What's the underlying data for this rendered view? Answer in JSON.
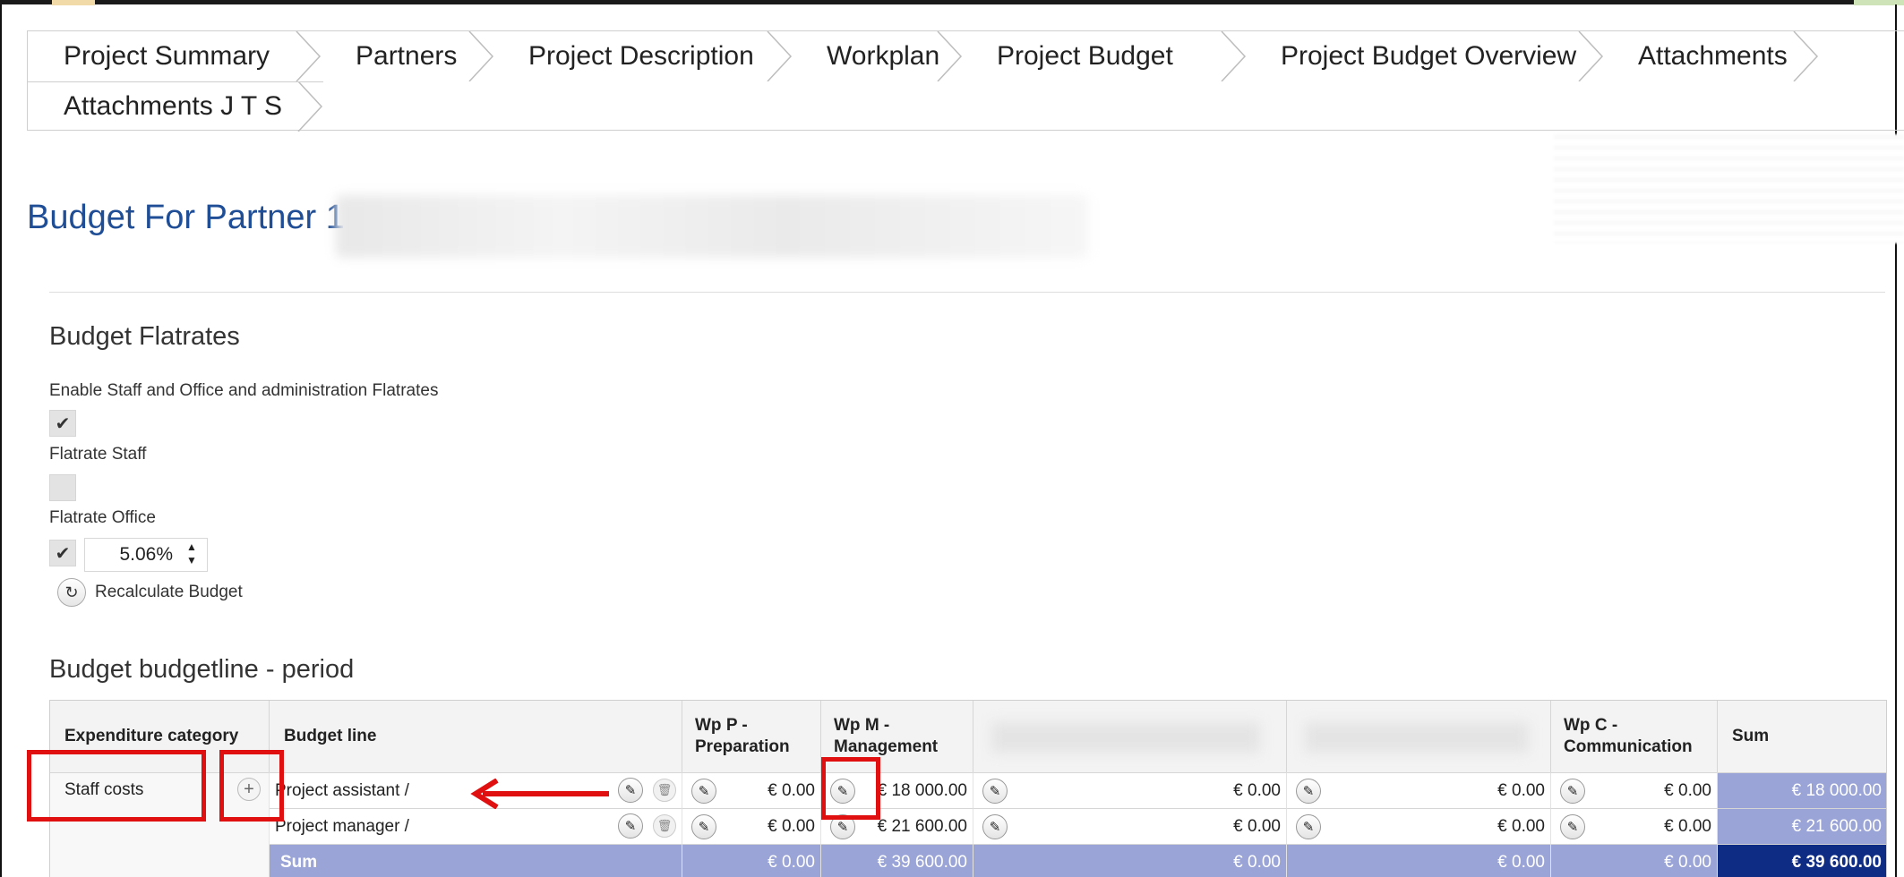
{
  "tabs": [
    {
      "label": "Project Summary"
    },
    {
      "label": "Partners"
    },
    {
      "label": "Project Description"
    },
    {
      "label": "Workplan"
    },
    {
      "label": "Project Budget"
    },
    {
      "label": "Project Budget Overview"
    },
    {
      "label": "Attachments"
    },
    {
      "label": "Attachments J T S"
    }
  ],
  "page_title": "Budget For Partner 1",
  "flatrates": {
    "heading": "Budget Flatrates",
    "enable_label": "Enable Staff and Office and administration Flatrates",
    "enable_checked": true,
    "staff_label": "Flatrate Staff",
    "staff_checked": false,
    "office_label": "Flatrate Office",
    "office_checked": true,
    "office_value": "5.06%",
    "recalculate_label": "Recalculate Budget"
  },
  "budget_table": {
    "heading": "Budget budgetline - period",
    "headers": {
      "category": "Expenditure category",
      "line": "Budget line",
      "wp_p": "Wp P - Preparation",
      "wp_m": "Wp M - Management",
      "wp_c": "Wp C - Communication",
      "sum": "Sum"
    },
    "category_name": "Staff costs",
    "rows": [
      {
        "line": "Project assistant /",
        "wp_p": "€ 0.00",
        "wp_m": "€ 18 000.00",
        "wp_t": "€ 0.00",
        "wp_i": "€ 0.00",
        "wp_c": "€ 0.00",
        "sum": "€ 18 000.00"
      },
      {
        "line": "Project manager /",
        "wp_p": "€ 0.00",
        "wp_m": "€ 21 600.00",
        "wp_t": "€ 0.00",
        "wp_i": "€ 0.00",
        "wp_c": "€ 0.00",
        "sum": "€ 21 600.00"
      }
    ],
    "sum_row": {
      "label": "Sum",
      "wp_p": "€ 0.00",
      "wp_m": "€ 39 600.00",
      "wp_t": "€ 0.00",
      "wp_i": "€ 0.00",
      "wp_c": "€ 0.00",
      "sum": "€ 39 600.00"
    }
  },
  "colors": {
    "title_blue": "#1f4e96",
    "sum_row": "#9aa4d6",
    "grand_total": "#0f2c85",
    "annotation_red": "#e01010"
  },
  "icons": [
    "pencil-icon",
    "trash-icon",
    "plus-icon",
    "refresh-icon",
    "check-icon"
  ]
}
